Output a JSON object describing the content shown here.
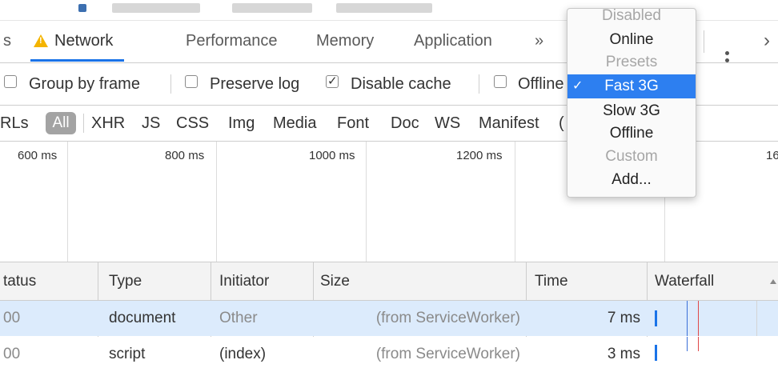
{
  "tabs": {
    "partial_left": "s",
    "network": "Network",
    "performance": "Performance",
    "memory": "Memory",
    "application": "Application",
    "more": "»",
    "right_partial": "›"
  },
  "options": {
    "group_by_frame": "Group by frame",
    "preserve_log": "Preserve log",
    "disable_cache": "Disable cache",
    "offline": "Offline",
    "disable_cache_checked": true
  },
  "filters": {
    "partial": "RLs",
    "all": "All",
    "types": [
      "XHR",
      "JS",
      "CSS",
      "Img",
      "Media",
      "Font",
      "Doc",
      "WS",
      "Manifest",
      "("
    ]
  },
  "timeline_ticks": [
    "600 ms",
    "800 ms",
    "1000 ms",
    "1200 ms",
    "16"
  ],
  "table": {
    "headers": [
      "tatus",
      "Type",
      "Initiator",
      "Size",
      "Time",
      "Waterfall"
    ],
    "rows": [
      {
        "status": "00",
        "type": "document",
        "initiator": "Other",
        "size": "(from ServiceWorker)",
        "time": "7 ms"
      },
      {
        "status": "00",
        "type": "script",
        "initiator": "(index)",
        "size": "(from ServiceWorker)",
        "time": "3 ms"
      }
    ]
  },
  "throttle_menu": {
    "items": [
      {
        "label": "Disabled",
        "kind": "header"
      },
      {
        "label": "Online",
        "kind": "item"
      },
      {
        "label": "Presets",
        "kind": "header"
      },
      {
        "label": "Fast 3G",
        "kind": "selected"
      },
      {
        "label": "Slow 3G",
        "kind": "item"
      },
      {
        "label": "Offline",
        "kind": "item"
      },
      {
        "label": "Custom",
        "kind": "header"
      },
      {
        "label": "Add...",
        "kind": "item"
      }
    ],
    "check": "✓"
  },
  "colors": {
    "accent": "#1a73e8",
    "selected_row": "#dcebfc",
    "menu_selected": "#2d7ff0",
    "warning": "#f4b400"
  }
}
